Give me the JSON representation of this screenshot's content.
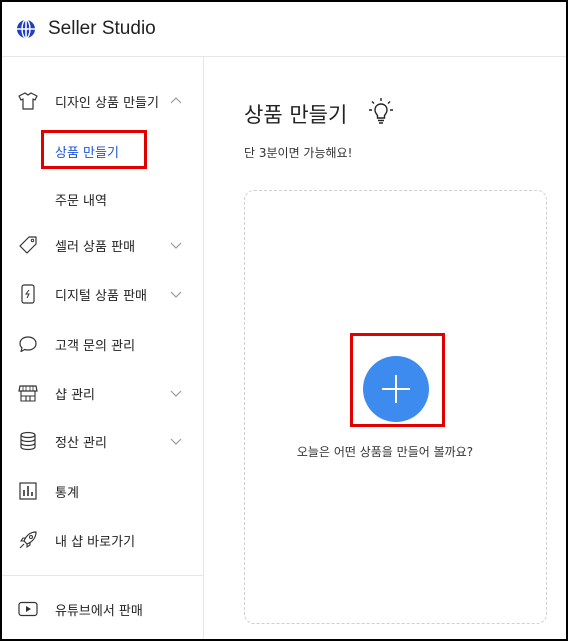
{
  "header": {
    "app_title": "Seller Studio",
    "logo_icon": "globe-icon"
  },
  "sidebar": {
    "items": [
      {
        "label": "디자인 상품 만들기",
        "icon": "tshirt-icon",
        "chevron": "up"
      },
      {
        "label": "셀러 상품 판매",
        "icon": "tag-icon",
        "chevron": "down"
      },
      {
        "label": "디지털 상품 판매",
        "icon": "phone-icon",
        "chevron": "down"
      },
      {
        "label": "고객 문의 관리",
        "icon": "chat-bubble-icon"
      },
      {
        "label": "샵 관리",
        "icon": "store-icon",
        "chevron": "down"
      },
      {
        "label": "정산 관리",
        "icon": "database-icon",
        "chevron": "down"
      },
      {
        "label": "통계",
        "icon": "bar-chart-icon"
      },
      {
        "label": "내 샵 바로가기",
        "icon": "rocket-icon"
      }
    ],
    "subitems": [
      {
        "label": "상품 만들기",
        "active": true
      },
      {
        "label": "주문 내역",
        "active": false
      }
    ],
    "footer_item": {
      "label": "유튜브에서 판매",
      "icon": "youtube-icon"
    }
  },
  "main": {
    "title": "상품 만들기",
    "title_icon": "lightbulb-icon",
    "subtitle": "단 3분이면 가능해요!",
    "add_prompt": "오늘은 어떤 상품을 만들어 볼까요?",
    "add_icon": "plus-icon"
  },
  "colors": {
    "accent": "#3d8bef",
    "active_link": "#1a56d6",
    "highlight": "#e00000"
  }
}
